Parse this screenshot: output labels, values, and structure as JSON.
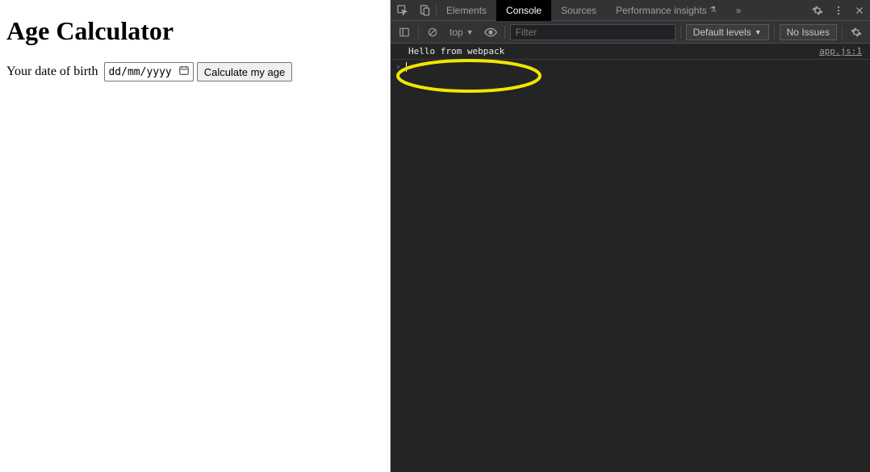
{
  "left": {
    "heading": "Age Calculator",
    "label": "Your date of birth",
    "date_placeholder": "dd/mm/yyyy",
    "button_label": "Calculate my age"
  },
  "devtools": {
    "tabs": {
      "elements": "Elements",
      "console": "Console",
      "sources": "Sources",
      "perf_insights": "Performance insights",
      "more": "»"
    },
    "toolbar": {
      "context": "top",
      "filter_placeholder": "Filter",
      "levels": "Default levels",
      "issues": "No Issues"
    },
    "console": {
      "log_message": "Hello from webpack",
      "log_source": "app.js:1",
      "prompt_symbol": "›"
    }
  }
}
